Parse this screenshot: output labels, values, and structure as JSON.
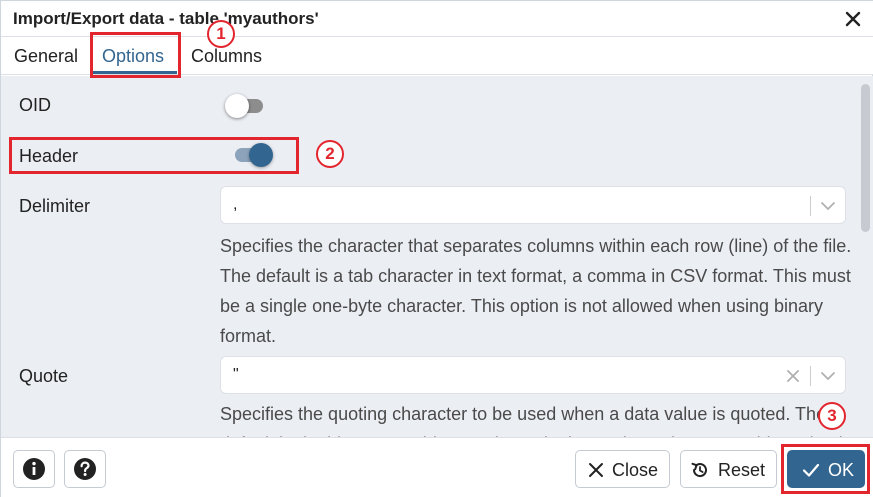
{
  "dialog": {
    "title": "Import/Export data - table 'myauthors'",
    "close_icon": "close-icon"
  },
  "tabs": [
    {
      "label": "General",
      "active": false
    },
    {
      "label": "Options",
      "active": true
    },
    {
      "label": "Columns",
      "active": false
    }
  ],
  "options": {
    "oid": {
      "label": "OID",
      "enabled": false
    },
    "header": {
      "label": "Header",
      "enabled": true
    },
    "delimiter": {
      "label": "Delimiter",
      "value": ",",
      "help": "Specifies the character that separates columns within each row (line) of the file. The default is a tab character in text format, a comma in CSV format. This must be a single one-byte character. This option is not allowed when using binary format."
    },
    "quote": {
      "label": "Quote",
      "value": "\"",
      "help": "Specifies the quoting character to be used when a data value is quoted. The default is double-quote. This must be a single one-byte character. This option is allowed only when using CSV format."
    }
  },
  "footer": {
    "info_icon": "info-icon",
    "help_icon": "help-icon",
    "close_label": "Close",
    "reset_label": "Reset",
    "ok_label": "OK"
  },
  "annotations": [
    "1",
    "2",
    "3"
  ],
  "colors": {
    "accent": "#326690",
    "annotation": "#e3262e",
    "body_background": "#ebeef3"
  }
}
